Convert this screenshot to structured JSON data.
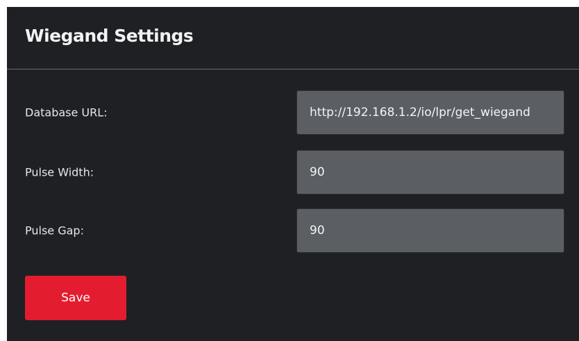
{
  "panel": {
    "title": "Wiegand Settings"
  },
  "form": {
    "database_url": {
      "label": "Database URL:",
      "value": "http://192.168.1.2/io/lpr/get_wiegand"
    },
    "pulse_width": {
      "label": "Pulse Width:",
      "value": "90"
    },
    "pulse_gap": {
      "label": "Pulse Gap:",
      "value": "90"
    }
  },
  "actions": {
    "save_label": "Save"
  },
  "colors": {
    "panel_background": "#1f2023",
    "input_background": "#5b5e63",
    "save_button": "#e31d2f",
    "page_background": "#ffffff"
  }
}
